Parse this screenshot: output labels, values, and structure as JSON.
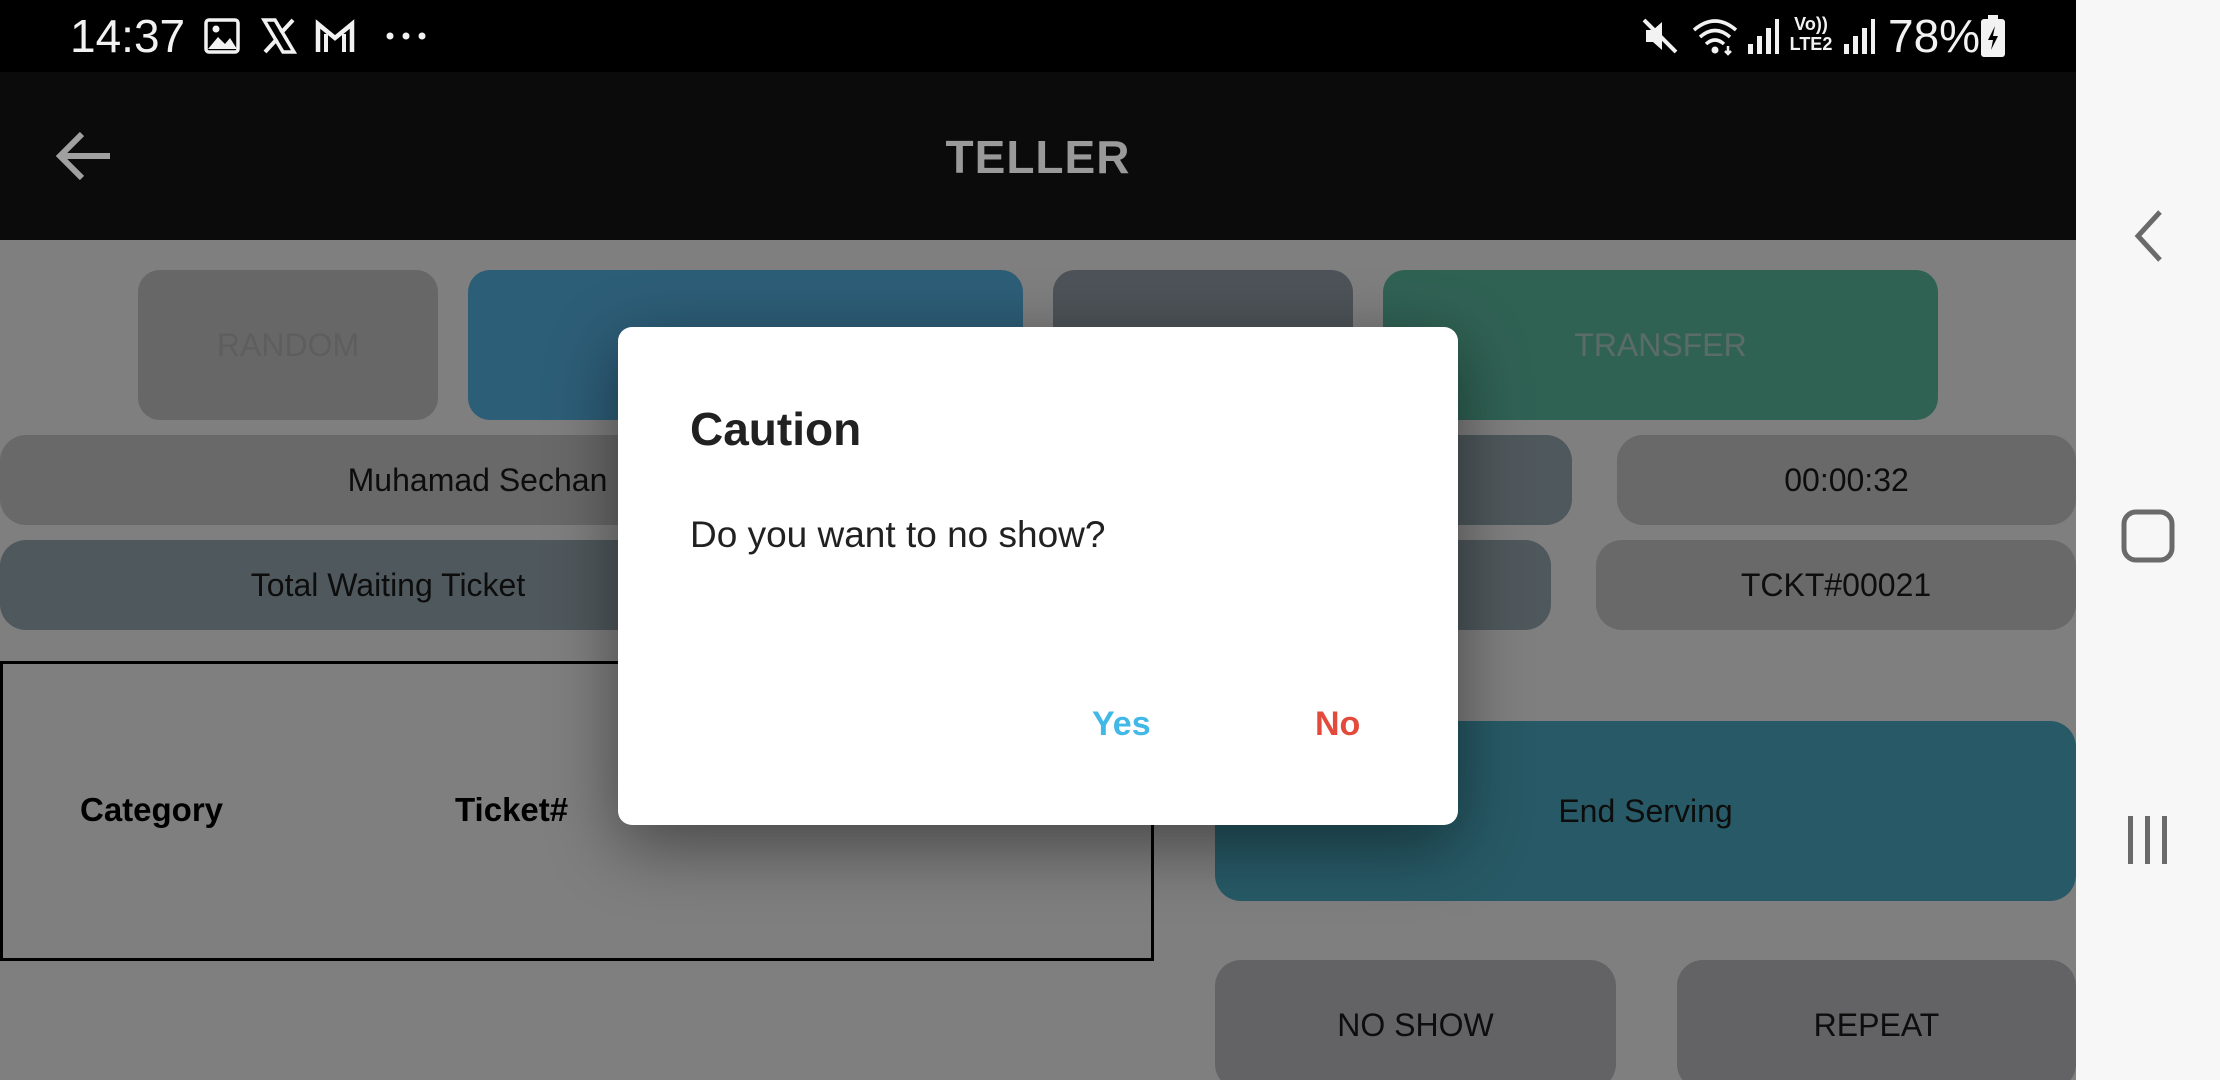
{
  "status_bar": {
    "time": "14:37",
    "battery": "78%",
    "icons": [
      "image-icon",
      "x-icon",
      "gmail-icon",
      "more-icon",
      "mute-icon",
      "wifi-icon",
      "signal-icon",
      "volte-lte2-icon",
      "signal-icon",
      "battery-charging-icon"
    ],
    "volte_line1": "Vo))",
    "volte_line2": "LTE2"
  },
  "app_bar": {
    "title": "TELLER",
    "back_icon": "arrow-back-icon"
  },
  "top_buttons": {
    "random": "RANDOM",
    "call": "",
    "recall": "",
    "transfer": "TRANSFER"
  },
  "info": {
    "teller_name": "Muhamad Sechan",
    "timer": "00:00:32",
    "total_waiting_label": "Total Waiting Ticket",
    "ticket_number": "TCKT#00021"
  },
  "table": {
    "headers": [
      "Category",
      "Ticket#",
      ""
    ]
  },
  "actions": {
    "end_serving": "End Serving",
    "no_show": "NO SHOW",
    "repeat": "REPEAT"
  },
  "dialog": {
    "title": "Caution",
    "message": "Do you want to no show?",
    "yes": "Yes",
    "no": "No"
  },
  "colors": {
    "status_bar": "#000000",
    "app_bar": "#0b0b0b",
    "blue_button": "#5bbcf0",
    "gray_button": "#9aa6b0",
    "green_button": "#61c4a8",
    "teal_button": "#4fb4cc",
    "yes": "#41b8e6",
    "no": "#e44a3c"
  }
}
